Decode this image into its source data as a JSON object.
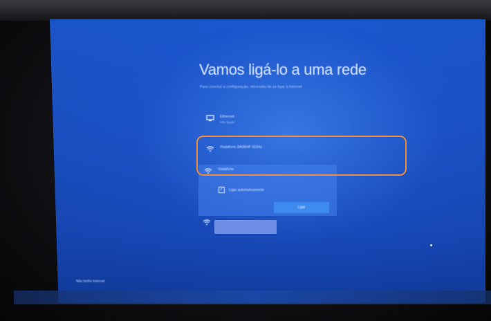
{
  "setup": {
    "title": "Vamos ligá-lo a uma rede",
    "subtitle": "Para concluir a configuração, necessita de se ligar à Internet"
  },
  "networks": [
    {
      "name": "Ethernet",
      "sub": "Não ligado",
      "icon": "ethernet-icon"
    },
    {
      "name": "Vodafone-8A9B4F-5GHz",
      "sub": "",
      "icon": "wifi-secured-icon"
    },
    {
      "name": "Vodafone",
      "sub": "",
      "icon": "wifi-secured-icon"
    }
  ],
  "expanded": {
    "auto_connect_label": "Ligar automaticamente",
    "connect_label": "Ligar"
  },
  "footer": {
    "link_label": "Não tenho Internet"
  },
  "colors": {
    "highlight": "#f08a35",
    "background": "#1a4fc0",
    "button": "#3e8bf0"
  }
}
